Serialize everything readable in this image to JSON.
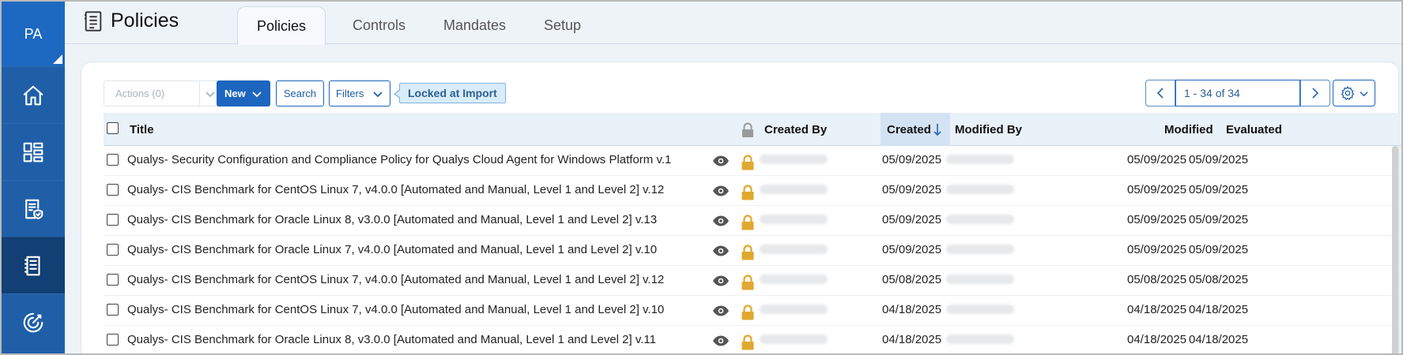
{
  "user": {
    "initials": "PA"
  },
  "header": {
    "title": "Policies",
    "tabs": [
      {
        "label": "Policies"
      },
      {
        "label": "Controls"
      },
      {
        "label": "Mandates"
      },
      {
        "label": "Setup"
      }
    ],
    "active_tab": "Policies"
  },
  "sidebar": {
    "items": [
      {
        "icon": "home-icon"
      },
      {
        "icon": "dashboard-icon"
      },
      {
        "icon": "compliance-report-icon"
      },
      {
        "icon": "policy-document-icon",
        "active": true
      },
      {
        "icon": "scan-gauge-icon"
      }
    ]
  },
  "toolbar": {
    "actions_label": "Actions (0)",
    "new_label": "New",
    "search_label": "Search",
    "filters_label": "Filters",
    "filter_tag": "Locked at Import"
  },
  "pager": {
    "range": "1 - 34 of 34"
  },
  "table": {
    "columns": {
      "title": "Title",
      "created_by": "Created By",
      "created": "Created",
      "modified_by": "Modified By",
      "modified": "Modified",
      "evaluated": "Evaluated"
    },
    "sort": {
      "column": "Created",
      "direction": "descending"
    },
    "rows": [
      {
        "title": "Qualys- Security Configuration and Compliance Policy for Qualys Cloud Agent for Windows Platform v.1",
        "created": "05/09/2025",
        "modified": "05/09/2025",
        "evaluated": "05/09/2025"
      },
      {
        "title": "Qualys- CIS Benchmark for CentOS Linux 7, v4.0.0 [Automated and Manual, Level 1 and Level 2] v.12",
        "created": "05/09/2025",
        "modified": "05/09/2025",
        "evaluated": "05/09/2025"
      },
      {
        "title": "Qualys- CIS Benchmark for Oracle Linux 8, v3.0.0 [Automated and Manual, Level 1 and Level 2] v.13",
        "created": "05/09/2025",
        "modified": "05/09/2025",
        "evaluated": "05/09/2025"
      },
      {
        "title": "Qualys- CIS Benchmark for Oracle Linux 7, v4.0.0 [Automated and Manual, Level 1 and Level 2] v.10",
        "created": "05/09/2025",
        "modified": "05/09/2025",
        "evaluated": "05/09/2025"
      },
      {
        "title": "Qualys- CIS Benchmark for CentOS Linux 7, v4.0.0 [Automated and Manual, Level 1 and Level 2] v.12",
        "created": "05/08/2025",
        "modified": "05/08/2025",
        "evaluated": "05/08/2025"
      },
      {
        "title": "Qualys- CIS Benchmark for CentOS Linux 7, v4.0.0 [Automated and Manual, Level 1 and Level 2] v.10",
        "created": "04/18/2025",
        "modified": "04/18/2025",
        "evaluated": "04/18/2025"
      },
      {
        "title": "Qualys- CIS Benchmark for Oracle Linux 8, v3.0.0 [Automated and Manual, Level 1 and Level 2] v.11",
        "created": "04/18/2025",
        "modified": "04/18/2025",
        "evaluated": "04/18/2025"
      }
    ]
  },
  "colors": {
    "sidebar": "#1f5fa8",
    "primary": "#1d66bf",
    "lock": "#e0a82e",
    "header_bg": "#e9f1f9"
  }
}
